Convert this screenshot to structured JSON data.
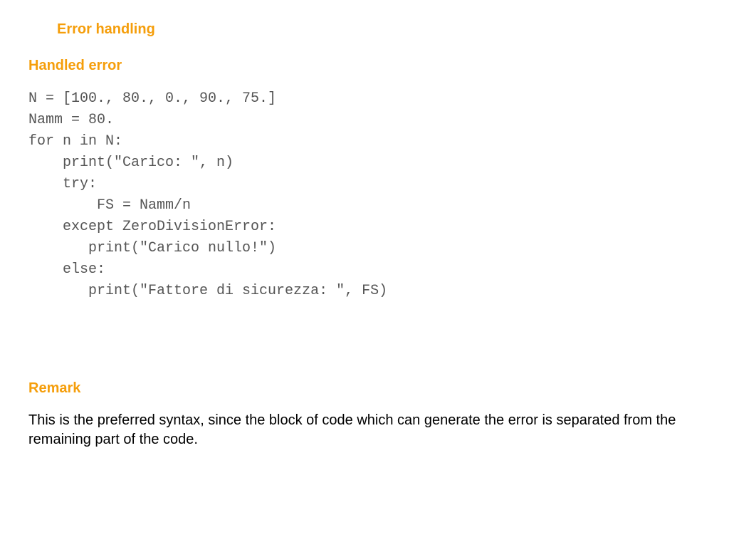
{
  "title_main": "Error handling",
  "subtitle": "Handled error",
  "code": "N = [100., 80., 0., 90., 75.]\nNamm = 80.\nfor n in N:\n    print(\"Carico: \", n)\n    try:\n        FS = Namm/n\n    except ZeroDivisionError:\n       print(\"Carico nullo!\")\n    else:\n       print(\"Fattore di sicurezza: \", FS)",
  "remark_title": "Remark",
  "remark_body": "This is the preferred syntax, since the block of code which can generate the error is separated from the remaining part of the code."
}
